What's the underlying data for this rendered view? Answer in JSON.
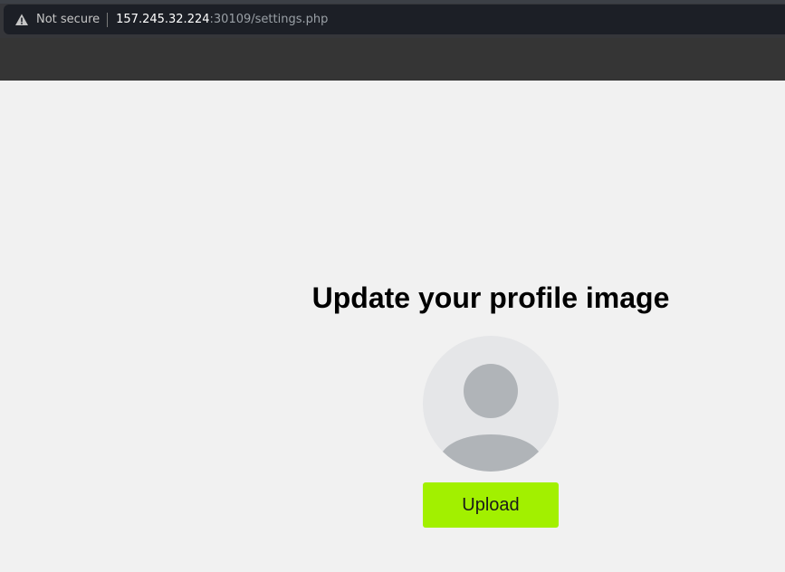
{
  "browser": {
    "security_label": "Not secure",
    "url_host": "157.245.32.224",
    "url_rest": ":30109/settings.php"
  },
  "page": {
    "heading": "Update your profile image",
    "avatar_icon": "user-silhouette",
    "upload_label": "Upload"
  },
  "colors": {
    "upload_button": "#a2f000",
    "avatar_bg": "#e5e6e8",
    "avatar_figure": "#b0b4b8",
    "page_bg": "#f1f1f1"
  }
}
